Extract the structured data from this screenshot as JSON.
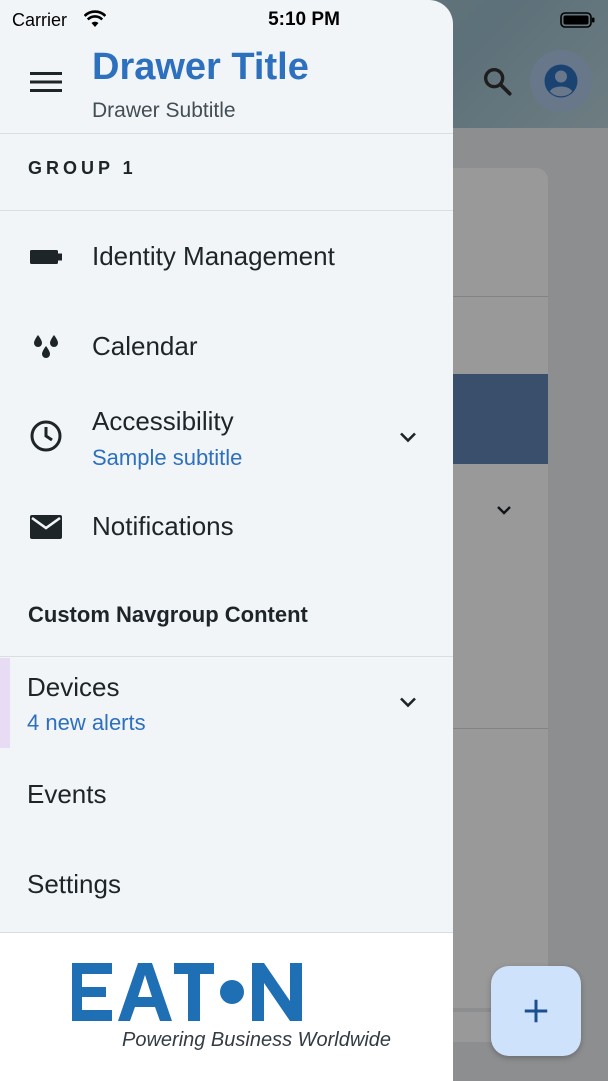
{
  "status_bar": {
    "carrier": "Carrier",
    "time": "5:10 PM"
  },
  "drawer": {
    "title": "Drawer Title",
    "subtitle": "Drawer Subtitle",
    "group1": {
      "title": "GROUP 1",
      "items": [
        {
          "label": "Identity Management",
          "icon": "battery-icon"
        },
        {
          "label": "Calendar",
          "icon": "droplets-icon"
        },
        {
          "label": "Accessibility",
          "subtitle": "Sample subtitle",
          "icon": "clock-icon",
          "expandable": true
        },
        {
          "label": "Notifications",
          "icon": "mail-icon"
        }
      ]
    },
    "custom_group": {
      "title": "Custom Navgroup Content",
      "items": [
        {
          "label": "Devices",
          "subtitle": "4 new alerts",
          "expandable": true,
          "active": true
        },
        {
          "label": "Events"
        },
        {
          "label": "Settings"
        }
      ]
    },
    "footer": {
      "logo": "EATON",
      "tagline": "Powering Business Worldwide"
    }
  },
  "colors": {
    "accent": "#2d70be",
    "drawer_bg": "#f2f5f8",
    "text": "#1d2529",
    "active_indicator": "#e8dcf5",
    "fab_bg": "#cfe2fb"
  }
}
